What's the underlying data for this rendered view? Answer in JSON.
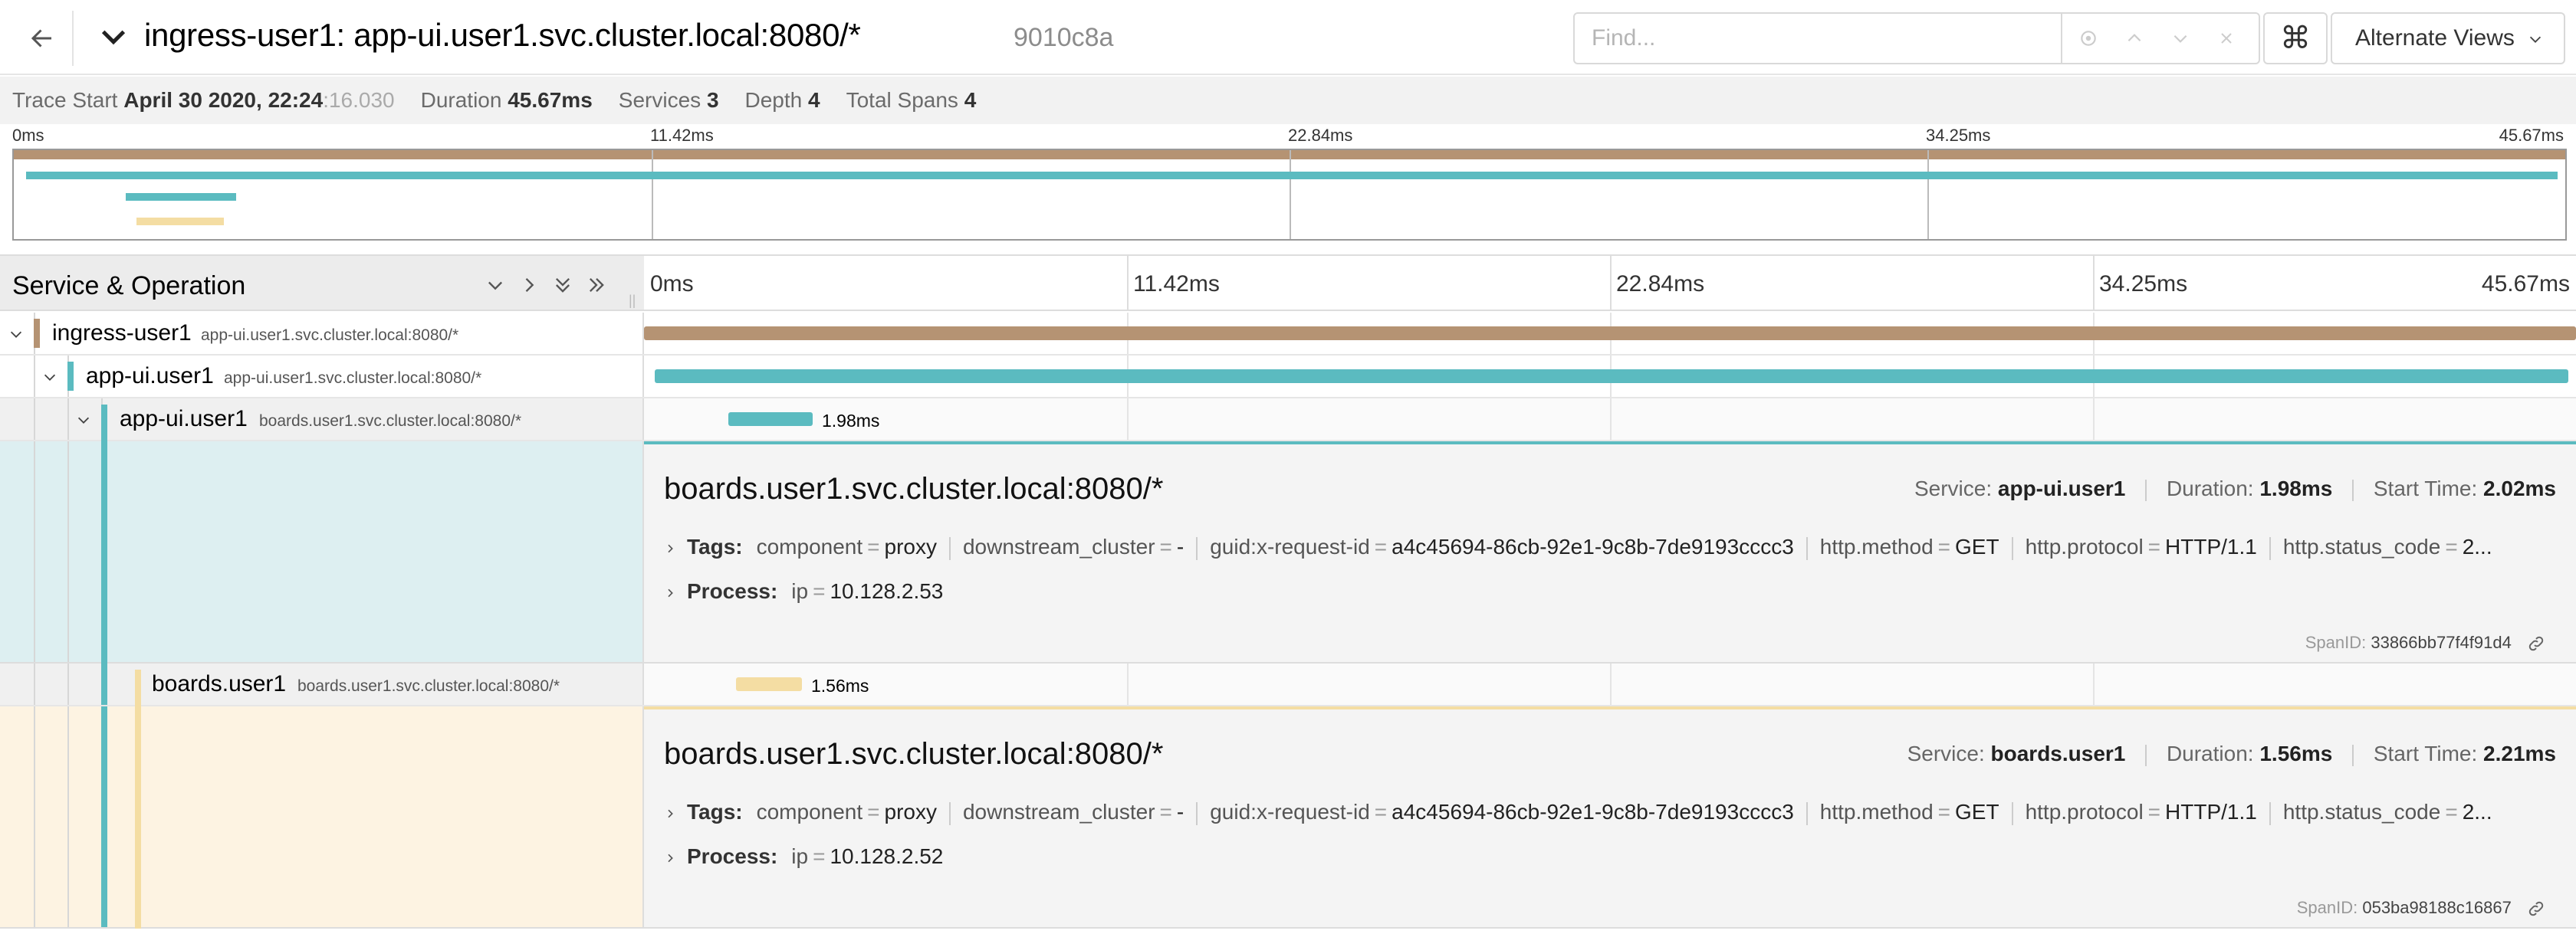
{
  "header": {
    "title": "ingress-user1: app-ui.user1.svc.cluster.local:8080/*",
    "trace_id": "9010c8a",
    "find_placeholder": "Find...",
    "kbd_symbol": "⌘",
    "alt_views_label": "Alternate Views"
  },
  "meta": {
    "trace_start_label": "Trace Start",
    "trace_start_value": "April 30 2020, 22:24",
    "trace_start_seconds": ":16.030",
    "duration_label": "Duration",
    "duration_value": "45.67ms",
    "services_label": "Services",
    "services_value": "3",
    "depth_label": "Depth",
    "depth_value": "4",
    "total_spans_label": "Total Spans",
    "total_spans_value": "4"
  },
  "ticks": [
    "0ms",
    "11.42ms",
    "22.84ms",
    "34.25ms",
    "45.67ms"
  ],
  "timeline": {
    "title": "Service & Operation"
  },
  "colors": {
    "ingress": "#b59373",
    "app_ui": "#5bbbc0",
    "boards": "#f4dda3",
    "app_ui_panel": "#ddeff1",
    "boards_panel": "#fdf3e2"
  },
  "spans": [
    {
      "service": "ingress-user1",
      "operation": "app-ui.user1.svc.cluster.local:8080/*",
      "duration": ""
    },
    {
      "service": "app-ui.user1",
      "operation": "app-ui.user1.svc.cluster.local:8080/*",
      "duration": ""
    },
    {
      "service": "app-ui.user1",
      "operation": "boards.user1.svc.cluster.local:8080/*",
      "duration": "1.98ms"
    },
    {
      "service": "boards.user1",
      "operation": "boards.user1.svc.cluster.local:8080/*",
      "duration": "1.56ms"
    }
  ],
  "details": [
    {
      "title": "boards.user1.svc.cluster.local:8080/*",
      "service_label": "Service:",
      "service": "app-ui.user1",
      "duration_label": "Duration:",
      "duration": "1.98ms",
      "start_label": "Start Time:",
      "start": "2.02ms",
      "tags_label": "Tags:",
      "tags": [
        {
          "k": "component",
          "v": "proxy"
        },
        {
          "k": "downstream_cluster",
          "v": "-"
        },
        {
          "k": "guid:x-request-id",
          "v": "a4c45694-86cb-92e1-9c8b-7de9193cccc3"
        },
        {
          "k": "http.method",
          "v": "GET"
        },
        {
          "k": "http.protocol",
          "v": "HTTP/1.1"
        },
        {
          "k": "http.status_code",
          "v": "2..."
        }
      ],
      "process_label": "Process:",
      "process": [
        {
          "k": "ip",
          "v": "10.128.2.53"
        }
      ],
      "spanid_label": "SpanID:",
      "spanid": "33866bb77f4f91d4"
    },
    {
      "title": "boards.user1.svc.cluster.local:8080/*",
      "service_label": "Service:",
      "service": "boards.user1",
      "duration_label": "Duration:",
      "duration": "1.56ms",
      "start_label": "Start Time:",
      "start": "2.21ms",
      "tags_label": "Tags:",
      "tags": [
        {
          "k": "component",
          "v": "proxy"
        },
        {
          "k": "downstream_cluster",
          "v": "-"
        },
        {
          "k": "guid:x-request-id",
          "v": "a4c45694-86cb-92e1-9c8b-7de9193cccc3"
        },
        {
          "k": "http.method",
          "v": "GET"
        },
        {
          "k": "http.protocol",
          "v": "HTTP/1.1"
        },
        {
          "k": "http.status_code",
          "v": "2..."
        }
      ],
      "process_label": "Process:",
      "process": [
        {
          "k": "ip",
          "v": "10.128.2.52"
        }
      ],
      "spanid_label": "SpanID:",
      "spanid": "053ba98188c16867"
    }
  ]
}
